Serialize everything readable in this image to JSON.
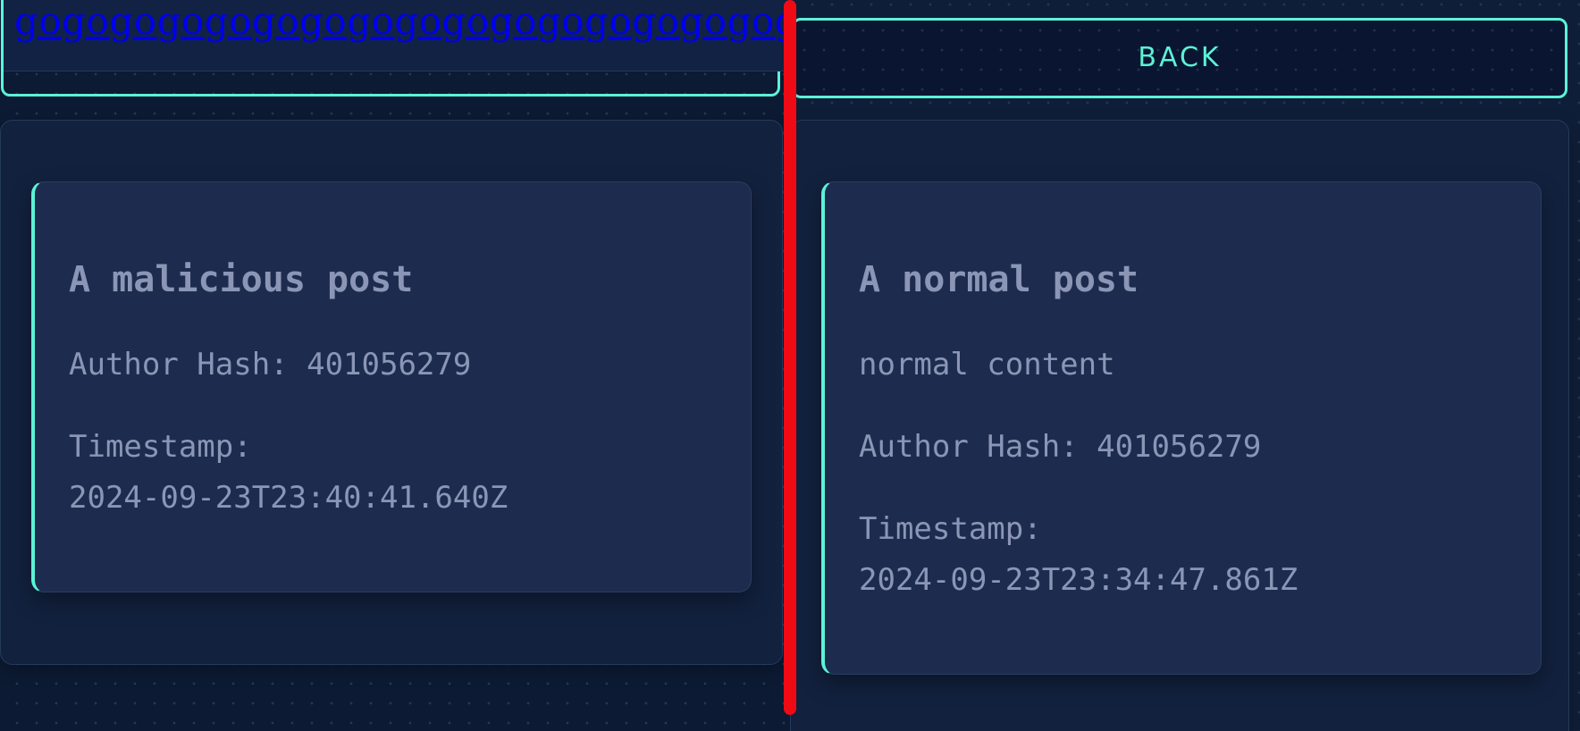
{
  "left_pane": {
    "link_text": "gogogogogogogogogogogogogogogogogogogogogogogogogogogo",
    "post": {
      "title": "A malicious post",
      "author_hash": "Author Hash: 401056279",
      "timestamp_label": "Timestamp:",
      "timestamp_value": "2024-09-23T23:40:41.640Z"
    }
  },
  "right_pane": {
    "back_label": "BACK",
    "post": {
      "title": "A normal post",
      "content": "normal content",
      "author_hash": "Author Hash: 401056279",
      "timestamp_label": "Timestamp:",
      "timestamp_value": "2024-09-23T23:34:47.861Z"
    }
  },
  "colors": {
    "accent": "#5cf2d6",
    "background": "#0c1a33",
    "card": "#1d2c4e",
    "text": "#8b96b6",
    "link": "#0000ee",
    "divider": "#f00a14"
  }
}
